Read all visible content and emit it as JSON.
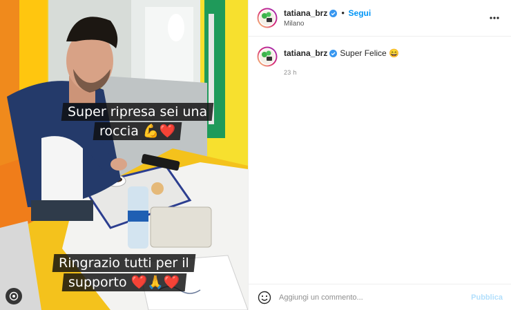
{
  "post": {
    "caption_lines_top": [
      "Super ripresa sei una",
      "roccia 💪❤️"
    ],
    "caption_lines_bottom": [
      "Ringrazio tutti per il",
      "supporto ❤️🙏❤️"
    ]
  },
  "header": {
    "username": "tatiana_brz",
    "separator": "•",
    "follow_label": "Segui",
    "location": "Milano"
  },
  "comment": {
    "username": "tatiana_brz",
    "text": "Super Felice 😄",
    "time": "23 h"
  },
  "add_comment": {
    "placeholder": "Aggiungi un commento...",
    "publish_label": "Pubblica"
  },
  "colors": {
    "accent": "#0095f6",
    "publish_disabled": "#b2dffc",
    "verified": "#3897f0"
  },
  "icons": {
    "verified": "verified-badge-icon",
    "more": "more-options-icon",
    "emoji": "emoji-icon",
    "igtv": "igtv-icon"
  }
}
